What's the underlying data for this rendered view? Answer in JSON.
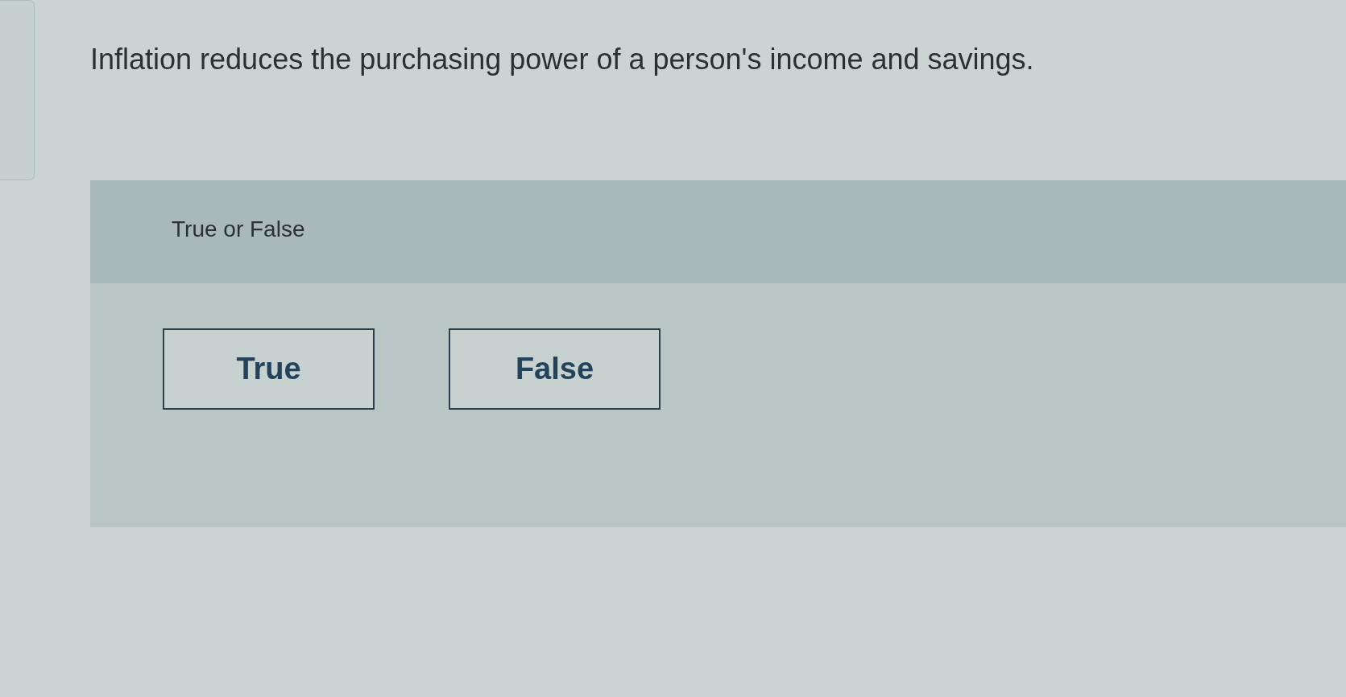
{
  "question": {
    "text": "Inflation reduces the purchasing power of a person's income and savings."
  },
  "prompt": "True or False",
  "options": [
    {
      "label": "True",
      "selected": false
    },
    {
      "label": "False",
      "selected": false
    }
  ]
}
